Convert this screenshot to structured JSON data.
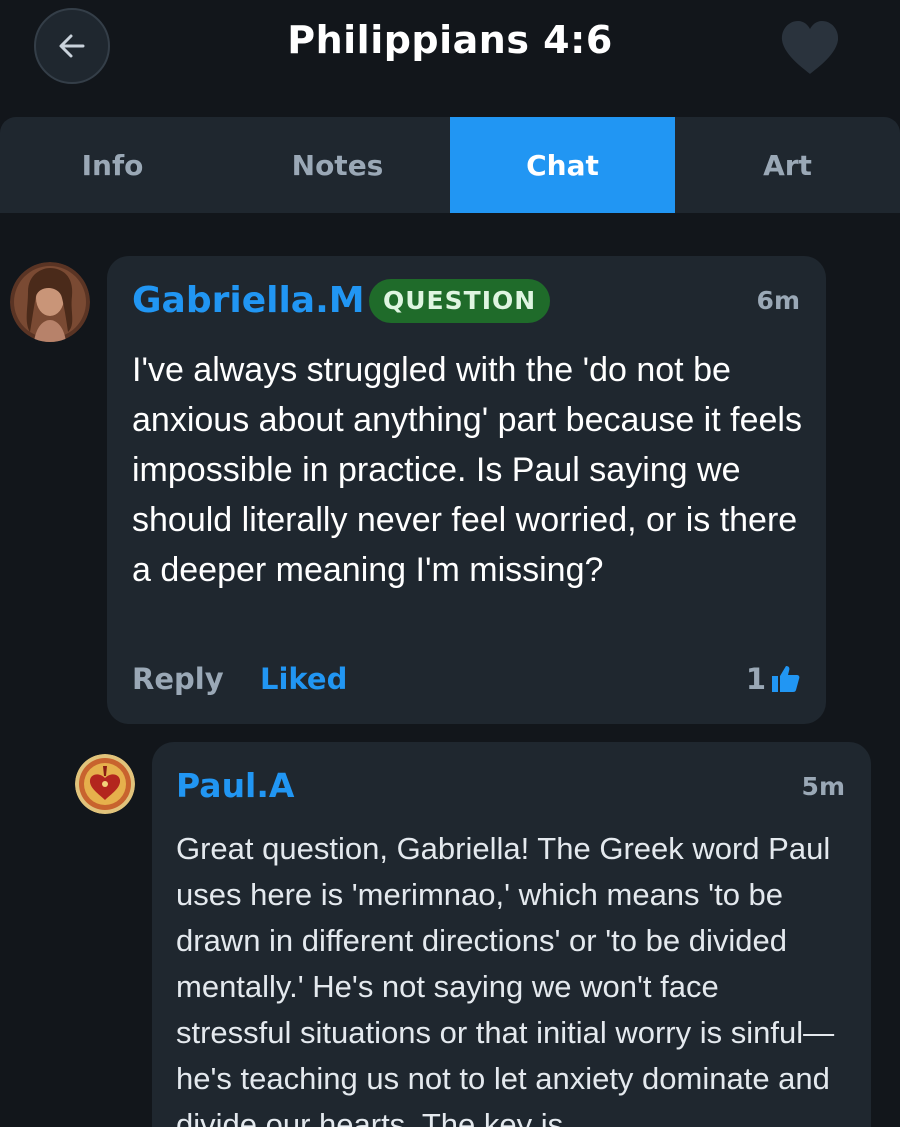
{
  "header": {
    "title": "Philippians 4:6"
  },
  "tabs": [
    {
      "label": "Info"
    },
    {
      "label": "Notes"
    },
    {
      "label": "Chat"
    },
    {
      "label": "Art"
    }
  ],
  "active_tab": "Chat",
  "colors": {
    "accent": "#2196f3",
    "background": "#12161b",
    "card": "#1f272f",
    "badge_green": "#1f6b2a"
  },
  "comments": [
    {
      "author": "Gabriella.M",
      "badge": "QUESTION",
      "time": "6m",
      "text": "I've always struggled with the 'do not be anxious about anything' part because it feels impossible in practice. Is Paul saying we should literally never feel worried, or is there a deeper meaning I'm missing?",
      "reply_label": "Reply",
      "liked_label": "Liked",
      "like_count": "1",
      "like_icon": "thumbs-up-icon"
    },
    {
      "author": "Paul.A",
      "time": "5m",
      "text": "Great question, Gabriella! The Greek word Paul uses here is 'merimnao,' which means 'to be drawn in different directions' or 'to be divided mentally.' He's not saying we won't face stressful situations or that initial worry is sinful—he's teaching us not to let anxiety dominate and divide our hearts. The key is"
    }
  ]
}
